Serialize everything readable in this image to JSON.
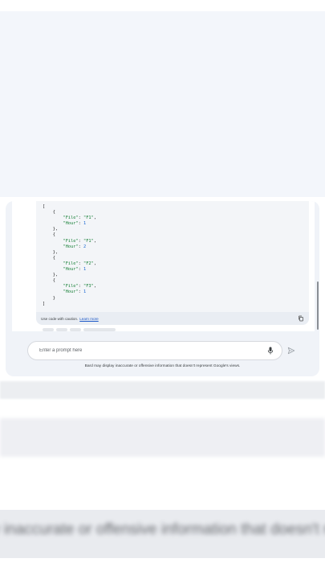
{
  "code_block": {
    "lines": [
      {
        "indent": "",
        "text": "["
      },
      {
        "indent": "    ",
        "text": "{"
      },
      {
        "indent": "        ",
        "key": "\"File\"",
        "value": "\"F1\"",
        "tail": ","
      },
      {
        "indent": "        ",
        "key": "\"Hour\"",
        "value": "1",
        "tail": ""
      },
      {
        "indent": "    ",
        "text": "},"
      },
      {
        "indent": "    ",
        "text": "{"
      },
      {
        "indent": "        ",
        "key": "\"File\"",
        "value": "\"F1\"",
        "tail": ","
      },
      {
        "indent": "        ",
        "key": "\"Hour\"",
        "value": "2",
        "tail": ""
      },
      {
        "indent": "    ",
        "text": "},"
      },
      {
        "indent": "    ",
        "text": "{"
      },
      {
        "indent": "        ",
        "key": "\"File\"",
        "value": "\"F2\"",
        "tail": ","
      },
      {
        "indent": "        ",
        "key": "\"Hour\"",
        "value": "1",
        "tail": ""
      },
      {
        "indent": "    ",
        "text": "},"
      },
      {
        "indent": "    ",
        "text": "{"
      },
      {
        "indent": "        ",
        "key": "\"File\"",
        "value": "\"F3\"",
        "tail": ","
      },
      {
        "indent": "        ",
        "key": "\"Hour\"",
        "value": "1",
        "tail": ""
      },
      {
        "indent": "    ",
        "text": "}"
      },
      {
        "indent": "",
        "text": "]"
      }
    ],
    "caution_text": "Use code with caution.",
    "learn_more": "Learn more",
    "copy_icon": "copy-icon"
  },
  "prompt": {
    "placeholder": "Enter a prompt here",
    "value": "",
    "mic_icon": "mic-icon",
    "send_icon": "send-icon"
  },
  "disclaimer": "Bard may display inaccurate or offensive information that doesn't represent Google's views.",
  "background_blur_text": "y inaccurate or offensive information that doesn't represen",
  "colors": {
    "accent": "#1a56c7",
    "code_string": "#188038",
    "card_bg": "#f0f3f8"
  }
}
